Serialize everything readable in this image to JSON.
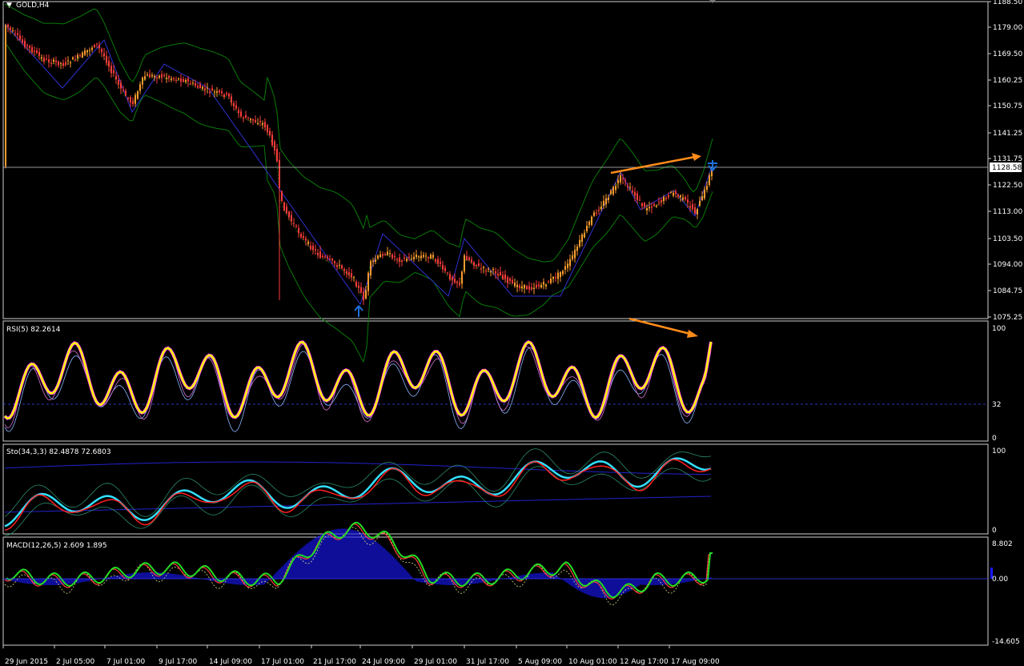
{
  "window": {
    "symbol_title": "GOLD,H4",
    "menu_glyph": "▼"
  },
  "colors": {
    "background": "#000000",
    "grid": "#cfcfcf",
    "bull_candle": "#ff9a2e",
    "bear_candle": "#ff3b3b",
    "bollinger": "#0a7a0a",
    "zigzag": "#3030d0",
    "arrow": "#ff8c1a",
    "signal_marker": "#1e6fd8",
    "rsi_main": "#ffff00",
    "rsi_highlight": "#ff30ff",
    "stoch_main": "#33e0ff",
    "stoch_signal": "#ff2020",
    "macd_line": "#22dd22",
    "macd_hist": "#1818ff",
    "price_line": "#c8c8c8"
  },
  "price_axis": {
    "ticks": [
      "1188.50",
      "1179.00",
      "1169.50",
      "1160.25",
      "1150.75",
      "1141.25",
      "1131.75",
      "1122.50",
      "1113.00",
      "1103.50",
      "1094.00",
      "1084.75",
      "1075.25"
    ],
    "current_price": "1128.58"
  },
  "rsi_panel": {
    "label": "RSI(5) 82.2614",
    "scale_top": "100",
    "scale_level": "32",
    "scale_bottom": "0"
  },
  "stoch_panel": {
    "label": "Sto(34,3,3) 82.4878 72.6803",
    "scale_top": "100",
    "scale_bottom": "0"
  },
  "macd_panel": {
    "label": "MACD(12,26,5) 2.609 1.895",
    "scale_top": "8.802",
    "scale_zero": "0.00",
    "scale_bottom": "-14.605"
  },
  "time_axis": {
    "labels": [
      "29 Jun 2015",
      "2 Jul 05:00",
      "7 Jul 01:00",
      "9 Jul 17:00",
      "14 Jul 09:00",
      "17 Jul 01:00",
      "21 Jul 17:00",
      "24 Jul 09:00",
      "29 Jul 01:00",
      "31 Jul 17:00",
      "5 Aug 09:00",
      "10 Aug 01:00",
      "12 Aug 17:00",
      "17 Aug 09:00"
    ]
  }
}
